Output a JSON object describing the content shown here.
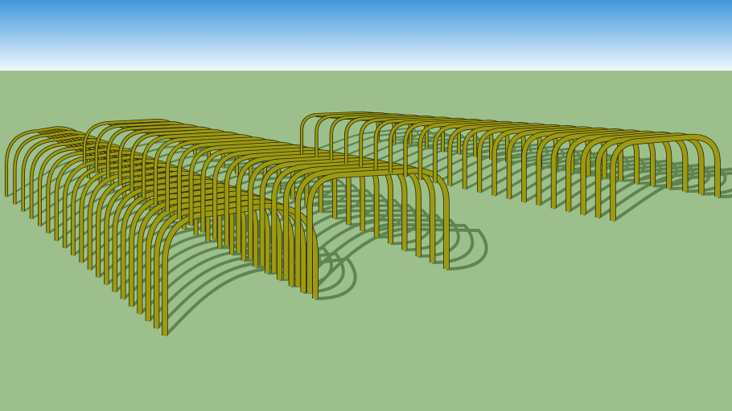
{
  "scene": {
    "sky_top": "#3f97dd",
    "sky_bottom": "#f2f8fc",
    "ground": "#9dbf8c",
    "shadow": "#5f8452",
    "member_fill": "#9c9a12",
    "member_outline": "#2b2a05"
  },
  "structures": [
    {
      "name": "left-front-pergola",
      "arch_count": 20
    },
    {
      "name": "left-rear-pergola",
      "arch_count": 20
    },
    {
      "name": "right-pergola",
      "arch_count": 22
    }
  ]
}
